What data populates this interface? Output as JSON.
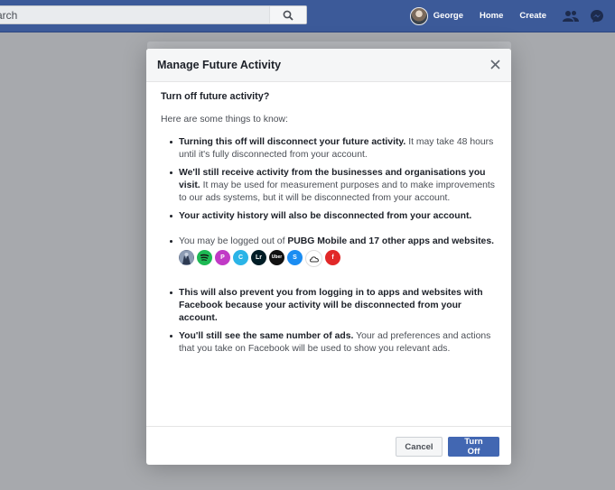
{
  "topbar": {
    "search_placeholder": "Search",
    "search_visible_text": "arch",
    "profile_name": "George",
    "home_label": "Home",
    "create_label": "Create",
    "icons": [
      "search-icon",
      "friends-icon",
      "messenger-icon"
    ],
    "color": "#3c5a99"
  },
  "modal": {
    "title": "Manage Future Activity",
    "question": "Turn off future activity?",
    "intro": "Here are some things to know:",
    "items": [
      {
        "bold": "Turning this off will disconnect your future activity.",
        "text": " It may take 48 hours until it's fully disconnected from your account."
      },
      {
        "bold": "We'll still receive activity from the businesses and organisations you visit.",
        "text": " It may be used for measurement purposes and to make improvements to our ads systems, but it will be disconnected from your account."
      },
      {
        "bold": "Your activity history will also be disconnected from your account.",
        "text": ""
      },
      {
        "prefix": "You may be logged out of ",
        "bold": "PUBG Mobile and 17 other apps and websites.",
        "text": ""
      },
      {
        "bold": "This will also prevent you from logging in to apps and websites with Facebook because your activity will be disconnected from your account.",
        "text": ""
      },
      {
        "bold": "You'll still see the same number of ads.",
        "text": " Your ad preferences and actions that you take on Facebook will be used to show you relevant ads."
      }
    ],
    "apps": [
      {
        "name": "pubg-app-icon",
        "label": "",
        "color": "#6f7d96"
      },
      {
        "name": "spotify-app-icon",
        "label": "",
        "color": "#1db954"
      },
      {
        "name": "picsart-app-icon",
        "label": "P",
        "color": "#c13ac6"
      },
      {
        "name": "canva-app-icon",
        "label": "C",
        "color": "#2bb4e7"
      },
      {
        "name": "lightroom-app-icon",
        "label": "Lr",
        "color": "#001d26"
      },
      {
        "name": "uber-app-icon",
        "label": "Uber",
        "color": "#111111"
      },
      {
        "name": "shazam-app-icon",
        "label": "S",
        "color": "#1b8df2"
      },
      {
        "name": "cloud-app-icon",
        "label": "",
        "color": "#ffffff"
      },
      {
        "name": "flipboard-app-icon",
        "label": "f",
        "color": "#e12828"
      }
    ],
    "cancel_label": "Cancel",
    "turn_off_label": "Turn Off",
    "primary_color": "#4267b2"
  }
}
